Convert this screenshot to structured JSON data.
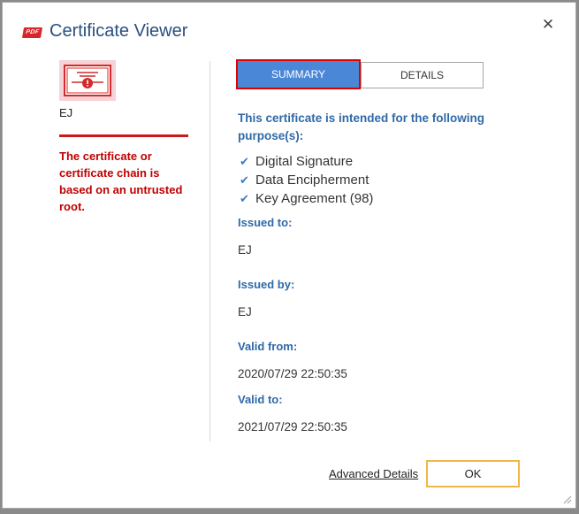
{
  "window": {
    "title": "Certificate Viewer",
    "logo_text": "PDF",
    "close_glyph": "✕"
  },
  "certificate": {
    "name": "EJ",
    "warning": "The certificate or certificate chain is based on an untrusted root."
  },
  "tabs": {
    "summary_label": "SUMMARY",
    "details_label": "DETAILS",
    "active": "SUMMARY"
  },
  "summary": {
    "purpose_heading": "This certificate is intended for the following purpose(s):",
    "purposes": [
      "Digital Signature",
      "Data Encipherment",
      "Key Agreement (98)"
    ],
    "issued_to_label": "Issued to:",
    "issued_to": "EJ",
    "issued_by_label": "Issued by:",
    "issued_by": "EJ",
    "valid_from_label": "Valid from:",
    "valid_from": "2020/07/29 22:50:35",
    "valid_to_label": "Valid to:",
    "valid_to": "2021/07/29 22:50:35"
  },
  "footer": {
    "advanced_label": "Advanced Details",
    "ok_label": "OK"
  },
  "colors": {
    "accent_blue": "#4b87d7",
    "heading_blue": "#2e6aa8",
    "warning_red": "#c00000",
    "ok_border": "#f2b64b"
  },
  "icons": [
    "pdf-logo-icon",
    "close-icon",
    "certificate-icon",
    "checkmark-icon",
    "resize-grip-icon"
  ]
}
